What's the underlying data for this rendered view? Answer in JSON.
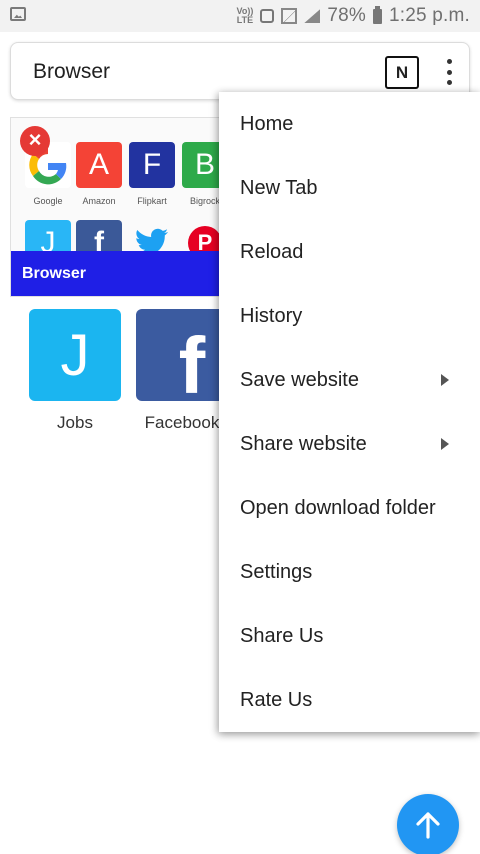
{
  "status_bar": {
    "volte_top": "Vo))",
    "volte_bottom": "LTE",
    "battery_percent": "78%",
    "time": "1:25 p.m."
  },
  "address_bar": {
    "title": "Browser",
    "n_button_label": "N"
  },
  "preview_card": {
    "tiles": [
      {
        "letter": "G",
        "label": "Google",
        "color": "#ffffff"
      },
      {
        "letter": "A",
        "label": "Amazon",
        "color": "#f44336"
      },
      {
        "letter": "F",
        "label": "Flipkart",
        "color": "#2233a0"
      },
      {
        "letter": "B",
        "label": "Bigrock",
        "color": "#2eaa4a"
      }
    ],
    "second_row": [
      {
        "letter": "J",
        "color": "#29b6f6"
      },
      {
        "letter": "f",
        "color": "#3b5998"
      },
      {
        "letter": "",
        "color": "#1da1f2"
      },
      {
        "letter": "P",
        "color": "#e60023"
      }
    ],
    "bar_title": "Browser",
    "bar_color": "#1f1fe6"
  },
  "tiles": [
    {
      "letter": "J",
      "label": "Jobs",
      "color": "#1bb5f0"
    },
    {
      "letter": "f",
      "label": "Facebook",
      "color": "#3b5ba0"
    }
  ],
  "menu": {
    "items": [
      {
        "label": "Home",
        "submenu": false
      },
      {
        "label": "New Tab",
        "submenu": false
      },
      {
        "label": "Reload",
        "submenu": false
      },
      {
        "label": "History",
        "submenu": false
      },
      {
        "label": "Save website",
        "submenu": true
      },
      {
        "label": "Share website",
        "submenu": true
      },
      {
        "label": "Open download folder",
        "submenu": false
      },
      {
        "label": "Settings",
        "submenu": false
      },
      {
        "label": "Share Us",
        "submenu": false
      },
      {
        "label": "Rate Us",
        "submenu": false
      }
    ]
  },
  "fab": {
    "icon": "arrow-up-icon",
    "color": "#2196f3"
  }
}
